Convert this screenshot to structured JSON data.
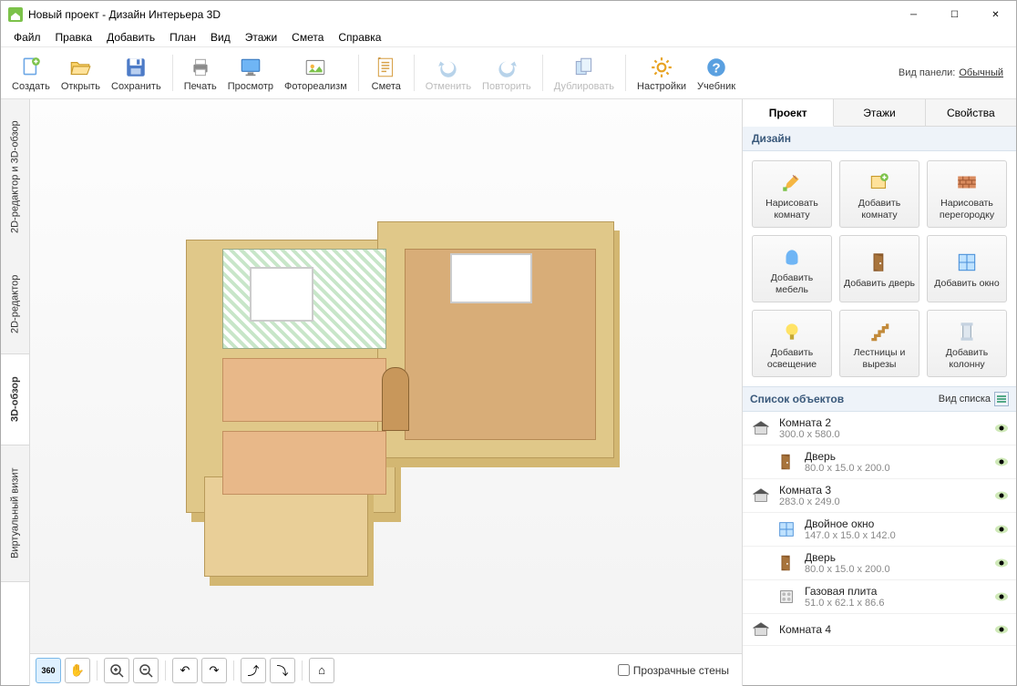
{
  "title": "Новый проект - Дизайн Интерьера 3D",
  "menu": [
    "Файл",
    "Правка",
    "Добавить",
    "План",
    "Вид",
    "Этажи",
    "Смета",
    "Справка"
  ],
  "toolbar": {
    "create": "Создать",
    "open": "Открыть",
    "save": "Сохранить",
    "print": "Печать",
    "preview": "Просмотр",
    "photoreal": "Фотореализм",
    "estimate": "Смета",
    "undo": "Отменить",
    "redo": "Повторить",
    "duplicate": "Дублировать",
    "settings": "Настройки",
    "tutorial": "Учебник",
    "panel_label": "Вид панели:",
    "panel_mode": "Обычный"
  },
  "left_tabs": {
    "t1": "2D-редактор и 3D-обзор",
    "t2": "2D-редактор",
    "t3": "3D-обзор",
    "t4": "Виртуальный визит"
  },
  "view_toolbar": {
    "transparent": "Прозрачные стены"
  },
  "right_tabs": {
    "project": "Проект",
    "floors": "Этажи",
    "props": "Свойства"
  },
  "design": {
    "header": "Дизайн",
    "b1": "Нарисовать комнату",
    "b2": "Добавить комнату",
    "b3": "Нарисовать перегородку",
    "b4": "Добавить мебель",
    "b5": "Добавить дверь",
    "b6": "Добавить окно",
    "b7": "Добавить освещение",
    "b8": "Лестницы и вырезы",
    "b9": "Добавить колонну"
  },
  "objects": {
    "header": "Список объектов",
    "mode": "Вид списка",
    "items": [
      {
        "name": "Комната 2",
        "dim": "300.0 x 580.0",
        "indent": false,
        "icon": "room"
      },
      {
        "name": "Дверь",
        "dim": "80.0 x 15.0 x 200.0",
        "indent": true,
        "icon": "door"
      },
      {
        "name": "Комната 3",
        "dim": "283.0 x 249.0",
        "indent": false,
        "icon": "room"
      },
      {
        "name": "Двойное окно",
        "dim": "147.0 x 15.0 x 142.0",
        "indent": true,
        "icon": "window"
      },
      {
        "name": "Дверь",
        "dim": "80.0 x 15.0 x 200.0",
        "indent": true,
        "icon": "door"
      },
      {
        "name": "Газовая плита",
        "dim": "51.0 x 62.1 x 86.6",
        "indent": true,
        "icon": "stove"
      },
      {
        "name": "Комната 4",
        "dim": "",
        "indent": false,
        "icon": "room"
      }
    ]
  }
}
